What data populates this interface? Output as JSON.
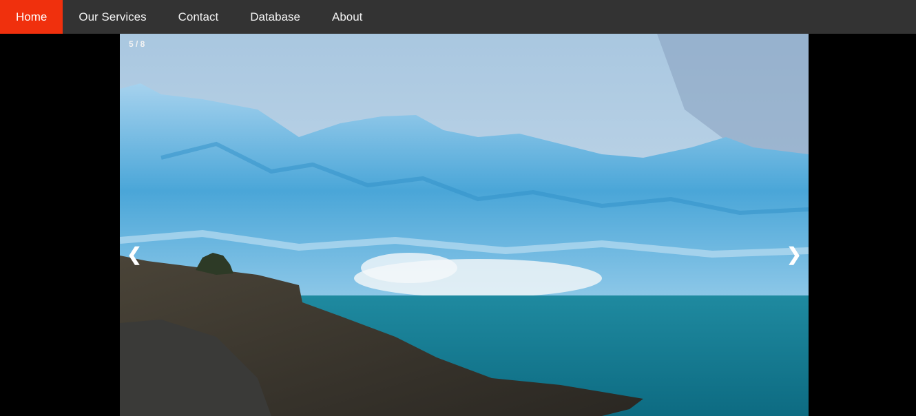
{
  "nav": {
    "items": [
      {
        "label": "Home",
        "active": true
      },
      {
        "label": "Our Services",
        "active": false
      },
      {
        "label": "Contact",
        "active": false
      },
      {
        "label": "Database",
        "active": false
      },
      {
        "label": "About",
        "active": false
      }
    ],
    "active_color": "#f0300d",
    "bar_color": "#333333"
  },
  "slideshow": {
    "counter": "5 / 8",
    "prev_glyph": "❮",
    "next_glyph": "❯",
    "image_subject": "glacier-lake-photo"
  }
}
